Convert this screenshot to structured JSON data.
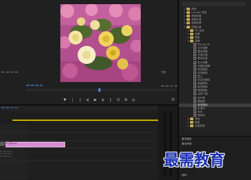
{
  "monitor": {
    "timecode_current": "00:00:04:24",
    "timecode_left_top": "00:00:00:00",
    "timecode_left_bottom": "00:00:00:00",
    "timecode_duration": "00:00:10:00",
    "zoom": "完整",
    "playback_progress": 0.49
  },
  "transport": {
    "mark_in": "▼",
    "mark_out": "|",
    "goto_in": "{",
    "step_back": "◂|",
    "play": "▶",
    "step_fwd": "|▸",
    "goto_out": "}",
    "lift": "⊡",
    "extract": "⊞",
    "export": "◎",
    "settings": "⚙"
  },
  "timeline": {
    "timecode": "00:00:04:24",
    "clip_label": "fx 花朵.jpg",
    "track_lines": [
      "00:00:00:0",
      "00:00:00:0",
      "00:00:00:0"
    ]
  },
  "effects": {
    "items": [
      {
        "label": "预设",
        "level": 0,
        "type": "folder"
      },
      {
        "label": "Lumetri 预设",
        "level": 0,
        "type": "folder"
      },
      {
        "label": "音频效果",
        "level": 0,
        "type": "folder"
      },
      {
        "label": "音频过渡",
        "level": 0,
        "type": "folder"
      },
      {
        "label": "视频效果",
        "level": 0,
        "type": "folder"
      },
      {
        "label": "视频过渡",
        "level": 0,
        "type": "folder",
        "open": true
      },
      {
        "label": "3D 运动",
        "level": 1,
        "type": "folder"
      },
      {
        "label": "划像",
        "level": 1,
        "type": "folder"
      },
      {
        "label": "擦除",
        "level": 1,
        "type": "folder"
      },
      {
        "label": "溶解",
        "level": 1,
        "type": "folder",
        "open": true
      },
      {
        "label": "MorphCut",
        "level": 2,
        "type": "fx"
      },
      {
        "label": "交叉溶解",
        "level": 2,
        "type": "fx"
      },
      {
        "label": "叠加溶解",
        "level": 2,
        "type": "fx"
      },
      {
        "label": "白场过渡",
        "level": 2,
        "type": "fx"
      },
      {
        "label": "黑场过渡",
        "level": 2,
        "type": "fx"
      },
      {
        "label": "胶片溶解",
        "level": 2,
        "type": "fx"
      },
      {
        "label": "非叠加溶解",
        "level": 2,
        "type": "fx"
      },
      {
        "label": "带状擦除",
        "level": 2,
        "type": "fx"
      },
      {
        "label": "径向擦除",
        "level": 2,
        "type": "fx"
      },
      {
        "label": "插入",
        "level": 2,
        "type": "fx"
      },
      {
        "label": "时钟式擦除",
        "level": 2,
        "type": "fx"
      },
      {
        "label": "棋盘擦除",
        "level": 2,
        "type": "fx"
      },
      {
        "label": "楔形擦除",
        "level": 2,
        "type": "fx"
      },
      {
        "label": "随机擦除",
        "level": 2,
        "type": "fx"
      },
      {
        "label": "油漆飞溅",
        "level": 2,
        "type": "fx"
      },
      {
        "label": "百叶窗",
        "level": 2,
        "type": "fx"
      },
      {
        "label": "螺旋框",
        "level": 2,
        "type": "fx"
      },
      {
        "label": "渐变擦除",
        "level": 2,
        "type": "fx",
        "selected": true
      },
      {
        "label": "水波块",
        "level": 2,
        "type": "fx"
      },
      {
        "label": "风车",
        "level": 2,
        "type": "fx"
      },
      {
        "label": "随机块",
        "level": 2,
        "type": "fx"
      },
      {
        "label": "滑动",
        "level": 1,
        "type": "folder"
      },
      {
        "label": "缩放",
        "level": 1,
        "type": "folder"
      },
      {
        "label": "页面剥落",
        "level": 1,
        "type": "folder"
      }
    ]
  },
  "lower_panel": {
    "title1": "基本图形",
    "title2": "基本声音",
    "title3": "音轨"
  },
  "watermark": "最需教育",
  "colors": {
    "accent_blue": "#4a8fd6",
    "clip_pink": "#d58fd0",
    "work_area": "#c8b100",
    "watermark_blue": "#1a2fb0"
  }
}
